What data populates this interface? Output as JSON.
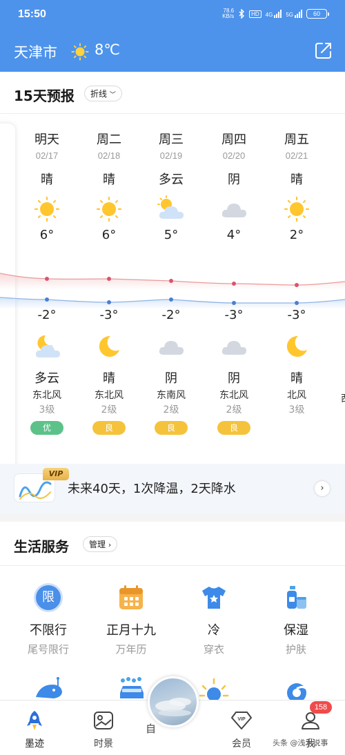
{
  "status_bar": {
    "time": "15:50",
    "net_speed_value": "78.6",
    "net_speed_unit": "KB/s",
    "hd": "HD",
    "net_4g": "4G",
    "net_5g": "5G",
    "battery": "60"
  },
  "header": {
    "city": "天津市",
    "current_temp": "8℃",
    "weather_icon": "sun-icon",
    "share_icon": "share-icon"
  },
  "forecast": {
    "title": "15天预报",
    "view_mode": "折线",
    "days": [
      {
        "name": "明天",
        "date": "02/17",
        "day_cond": "晴",
        "day_icon": "sun-icon",
        "high": "6°",
        "low": "-2°",
        "night_icon": "moon-cloud-icon",
        "night_cond": "多云",
        "wind_dir": "东北风",
        "wind_level": "3级",
        "aqi": "优",
        "aqi_color": "#5cc28a"
      },
      {
        "name": "周二",
        "date": "02/18",
        "day_cond": "晴",
        "day_icon": "sun-icon",
        "high": "6°",
        "low": "-3°",
        "night_icon": "moon-icon",
        "night_cond": "晴",
        "wind_dir": "东北风",
        "wind_level": "2级",
        "aqi": "良",
        "aqi_color": "#f5c33b"
      },
      {
        "name": "周三",
        "date": "02/19",
        "day_cond": "多云",
        "day_icon": "sun-cloud-icon",
        "high": "5°",
        "low": "-2°",
        "night_icon": "cloud-icon",
        "night_cond": "阴",
        "wind_dir": "东南风",
        "wind_level": "2级",
        "aqi": "良",
        "aqi_color": "#f5c33b"
      },
      {
        "name": "周四",
        "date": "02/20",
        "day_cond": "阴",
        "day_icon": "cloud-icon",
        "high": "4°",
        "low": "-3°",
        "night_icon": "cloud-icon",
        "night_cond": "阴",
        "wind_dir": "东北风",
        "wind_level": "2级",
        "aqi": "良",
        "aqi_color": "#f5c33b"
      },
      {
        "name": "周五",
        "date": "02/21",
        "day_cond": "晴",
        "day_icon": "sun-icon",
        "high": "2°",
        "low": "-3°",
        "night_icon": "moon-icon",
        "night_cond": "晴",
        "wind_dir": "北风",
        "wind_level": "3级",
        "aqi": "",
        "aqi_color": ""
      }
    ],
    "next_day_partial": "西"
  },
  "banner": {
    "vip": "VIP",
    "text": "未来40天，1次降温，2天降水"
  },
  "services": {
    "title": "生活服务",
    "manage": "管理",
    "items": [
      {
        "title": "不限行",
        "sub": "尾号限行",
        "icon": "restriction-icon",
        "icon_glyph": "限"
      },
      {
        "title": "正月十九",
        "sub": "万年历",
        "icon": "calendar-icon"
      },
      {
        "title": "冷",
        "sub": "穿衣",
        "icon": "clothing-icon"
      },
      {
        "title": "保湿",
        "sub": "护肤",
        "icon": "skincare-icon"
      }
    ]
  },
  "tabbar": {
    "tabs": [
      {
        "label": "墨迹",
        "icon": "rocket-icon"
      },
      {
        "label": "时景",
        "icon": "picture-icon"
      },
      {
        "label": "",
        "icon": "center-photo-icon"
      },
      {
        "label": "会员",
        "icon": "vip-diamond-icon"
      },
      {
        "label": "我",
        "icon": "profile-icon"
      }
    ],
    "badge": "158",
    "center_partial": "自"
  },
  "watermark": "头条 @浅水说事"
}
